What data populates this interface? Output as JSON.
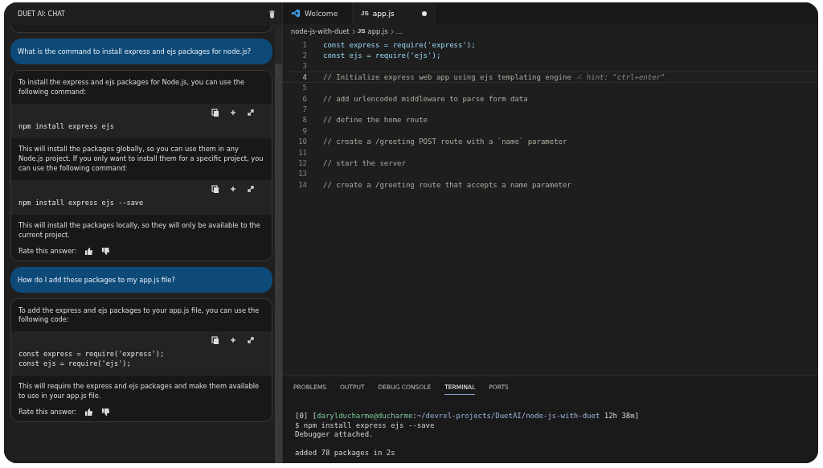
{
  "chat": {
    "title": "DUET AI: CHAT",
    "messages": [
      {
        "kind": "user",
        "text": "What is the command to install express and ejs packages for node.js?"
      },
      {
        "kind": "answer",
        "rate_label": "Rate this answer:",
        "parts": [
          {
            "kind": "text",
            "text": "To install the express and ejs packages for Node.js, you can use the following command:"
          },
          {
            "kind": "code",
            "lines": [
              "npm install express ejs"
            ]
          },
          {
            "kind": "text",
            "text": "This will install the packages globally, so you can use them in any Node.js project. If you only want to install them for a specific project, you can use the following command:"
          },
          {
            "kind": "code",
            "lines": [
              "npm install express ejs --save"
            ]
          },
          {
            "kind": "text",
            "text": "This will install the packages locally, so they will only be available to the current project."
          }
        ]
      },
      {
        "kind": "user",
        "text": "How do I add these packages to my app.js file?"
      },
      {
        "kind": "answer",
        "rate_label": "Rate this answer:",
        "parts": [
          {
            "kind": "text",
            "text": "To add the express and ejs packages to your app.js file, you can use the following code:"
          },
          {
            "kind": "code",
            "lines": [
              "const express = require('express');",
              "const ejs = require('ejs');"
            ]
          },
          {
            "kind": "text",
            "text": "This will require the express and ejs packages and make them available to use in your app.js file."
          }
        ]
      }
    ]
  },
  "tabs": [
    {
      "label": "Welcome",
      "kind": "welcome",
      "selected": false,
      "modified": false
    },
    {
      "label": "app.js",
      "kind": "js",
      "badge": "JS",
      "selected": true,
      "modified": true
    }
  ],
  "breadcrumb": [
    {
      "label": "node-js-with-duet"
    },
    {
      "label": "app.js",
      "badge": "JS"
    },
    {
      "label": "..."
    }
  ],
  "code": [
    {
      "number": "1",
      "kind": "code",
      "text": "const express = require('express');",
      "current": false
    },
    {
      "number": "2",
      "kind": "code",
      "text": "const ejs = require('ejs');",
      "current": false
    },
    {
      "number": "3",
      "kind": "blank",
      "current": false
    },
    {
      "number": "4",
      "kind": "comment",
      "text": "// Initialize express web app using ejs templating engine",
      "hint": "hint: \"ctrl+enter\"",
      "current": true
    },
    {
      "number": "5",
      "kind": "blank",
      "current": false
    },
    {
      "number": "6",
      "kind": "comment",
      "text": "// add urlencoded middleware to parse form data",
      "current": false
    },
    {
      "number": "7",
      "kind": "blank",
      "current": false
    },
    {
      "number": "8",
      "kind": "comment",
      "text": "// define the home route",
      "current": false
    },
    {
      "number": "9",
      "kind": "blank",
      "current": false
    },
    {
      "number": "10",
      "kind": "comment",
      "text": "// create a /greeting POST route with a `name` parameter",
      "current": false
    },
    {
      "number": "11",
      "kind": "blank",
      "current": false
    },
    {
      "number": "12",
      "kind": "comment",
      "text": "// start the server",
      "current": false
    },
    {
      "number": "13",
      "kind": "blank",
      "current": false
    },
    {
      "number": "14",
      "kind": "comment",
      "text": "// create a /greeting route that accepts a name parameter",
      "current": false
    }
  ],
  "panel_tabs": [
    {
      "label": "PROBLEMS",
      "selected": false
    },
    {
      "label": "OUTPUT",
      "selected": false
    },
    {
      "label": "DEBUG CONSOLE",
      "selected": false
    },
    {
      "label": "TERMINAL",
      "selected": true
    },
    {
      "label": "PORTS",
      "selected": false
    }
  ],
  "terminal": [
    {
      "parts": [
        {
          "kind": "plain",
          "text": "[0] ["
        },
        {
          "kind": "user",
          "text": "darylducharme@ducharme"
        },
        {
          "kind": "plain",
          "text": ":"
        },
        {
          "kind": "path",
          "text": "~/devrel-projects/DuetAI/node-js-with-duet"
        },
        {
          "kind": "time",
          "text": " 12h 38m"
        },
        {
          "kind": "plain",
          "text": "]"
        }
      ]
    },
    {
      "parts": [
        {
          "kind": "plain",
          "text": "$ npm install express ejs --save"
        }
      ]
    },
    {
      "parts": [
        {
          "kind": "plain",
          "text": "Debugger attached."
        }
      ]
    },
    {
      "blank_before": true,
      "parts": [
        {
          "kind": "plain",
          "text": "added 78 packages in 2s"
        }
      ]
    }
  ]
}
